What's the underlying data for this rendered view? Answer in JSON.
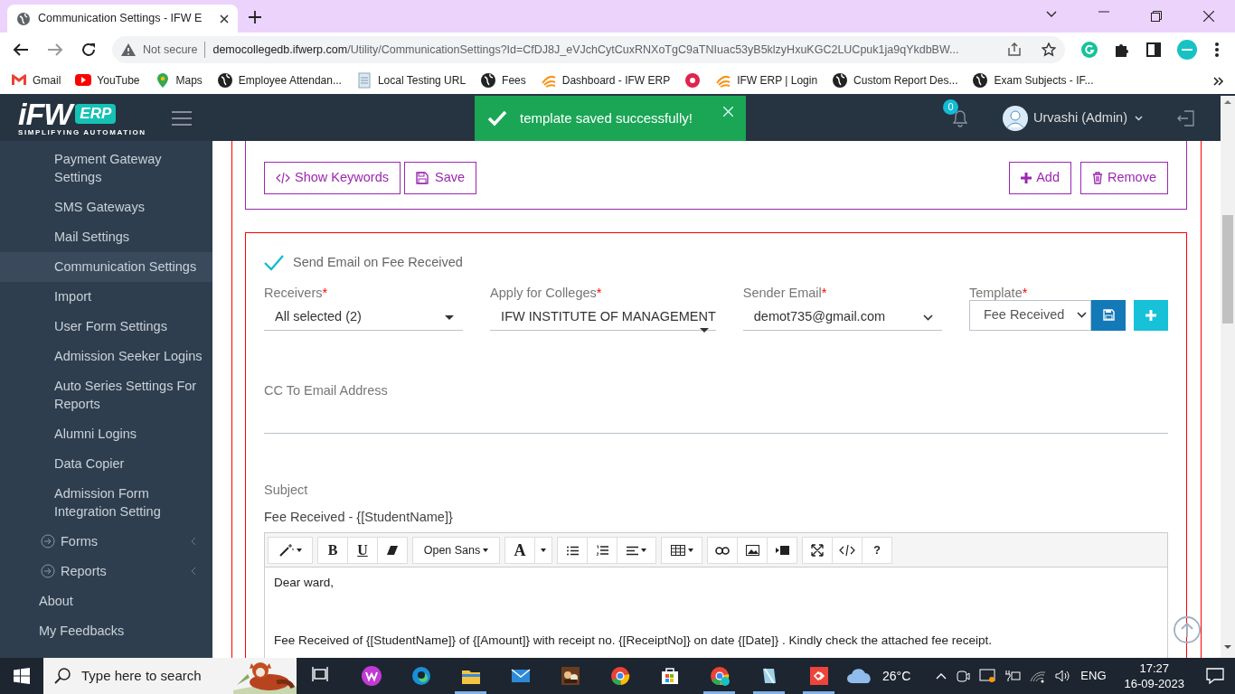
{
  "browser": {
    "tabs": [
      {
        "title": "Communication Settings - IFW E",
        "selected": true
      }
    ],
    "address": {
      "warning": "Not secure",
      "host": "democollegedb.ifwerp.com",
      "path": "/Utility/CommunicationSettings?Id=CfDJ8J_eVJchCytCuxRNXoTgC9aTNIuac53yB5klzyHxuKGC2LUCpuk1ja9qYkdbBW..."
    },
    "bookmarks": [
      {
        "kind": "link",
        "label": "Gmail"
      },
      {
        "kind": "link",
        "label": "YouTube"
      },
      {
        "kind": "link",
        "label": "Maps"
      },
      {
        "kind": "link",
        "label": "Employee Attendan..."
      },
      {
        "kind": "link",
        "label": "Local Testing URL"
      },
      {
        "kind": "link",
        "label": "Fees"
      },
      {
        "kind": "link",
        "label": "Dashboard - IFW ERP"
      },
      {
        "kind": "icon"
      },
      {
        "kind": "link",
        "label": "IFW ERP | Login"
      },
      {
        "kind": "link",
        "label": "Custom Report Des..."
      },
      {
        "kind": "link",
        "label": "Exam Subjects - IF..."
      }
    ]
  },
  "app": {
    "logo": {
      "mark": "iFW",
      "badge": "ERP",
      "tagline": "SIMPLIFYING AUTOMATION"
    },
    "notifications": {
      "count": "0"
    },
    "user": "Urvashi (Admin)",
    "toast": {
      "message": "template saved successfully!"
    },
    "sidebar": {
      "items": [
        {
          "kind": "sub",
          "label": "Payment Gateway Settings",
          "selected": false
        },
        {
          "kind": "sub",
          "label": "SMS Gateways",
          "selected": false
        },
        {
          "kind": "sub",
          "label": "Mail Settings",
          "selected": false
        },
        {
          "kind": "sub",
          "label": "Communication Settings",
          "selected": true
        },
        {
          "kind": "sub",
          "label": "Import",
          "selected": false
        },
        {
          "kind": "sub",
          "label": "User Form Settings",
          "selected": false
        },
        {
          "kind": "sub",
          "label": "Admission Seeker Logins",
          "selected": false
        },
        {
          "kind": "sub",
          "label": "Auto Series Settings For Reports",
          "selected": false
        },
        {
          "kind": "sub",
          "label": "Alumni Logins",
          "selected": false
        },
        {
          "kind": "sub",
          "label": "Data Copier",
          "selected": false
        },
        {
          "kind": "sub",
          "label": "Admission Form Integration Setting",
          "selected": false
        },
        {
          "kind": "group",
          "label": "Forms",
          "selected": false
        },
        {
          "kind": "group",
          "label": "Reports",
          "selected": false
        },
        {
          "kind": "top",
          "label": "About",
          "selected": false
        },
        {
          "kind": "top",
          "label": "My Feedbacks",
          "selected": false
        }
      ]
    },
    "actions": {
      "left": [
        "Show Keywords",
        "Save"
      ],
      "right": [
        "Add",
        "Remove"
      ]
    },
    "email_form": {
      "send_email": {
        "label": "Send Email on Fee Received",
        "checked": true
      },
      "fields": [
        {
          "label": "Receivers",
          "required_mark": "*",
          "value": "All selected (2)",
          "kind": "multiselect"
        },
        {
          "label": "Apply for Colleges",
          "required_mark": "*",
          "value": "IFW INSTITUTE OF MANAGEMENT",
          "kind": "multiselect"
        },
        {
          "label": "Sender Email",
          "required_mark": "*",
          "value": "demot735@gmail.com",
          "kind": "select"
        },
        {
          "label": "Template",
          "required_mark": "*",
          "value": "Fee Received",
          "kind": "template"
        }
      ],
      "cc": {
        "label": "CC To Email Address"
      },
      "subject": {
        "label": "Subject",
        "value": "Fee Received - {[StudentName]}"
      },
      "editor": {
        "toolbar": {
          "bold": "B",
          "underline": "U",
          "font": "Open Sans",
          "text_color": "A",
          "help": "?"
        },
        "body": [
          "Dear ward,",
          "Fee Received of {[StudentName]} of {[Amount]} with receipt no. {[ReceiptNo]} on date {[Date]} . Kindly check the attached fee receipt."
        ]
      }
    }
  },
  "taskbar": {
    "search_placeholder": "Type here to search",
    "apps": [
      {
        "running": false
      },
      {
        "running": false
      },
      {
        "running": false
      },
      {
        "running": true
      },
      {
        "running": false
      },
      {
        "running": false
      },
      {
        "running": false
      },
      {
        "running": false
      },
      {
        "running": true
      },
      {
        "running": true
      },
      {
        "running": true
      }
    ],
    "weather": "26°C",
    "language": "ENG",
    "time": "17:27",
    "date": "16-09-2023"
  }
}
